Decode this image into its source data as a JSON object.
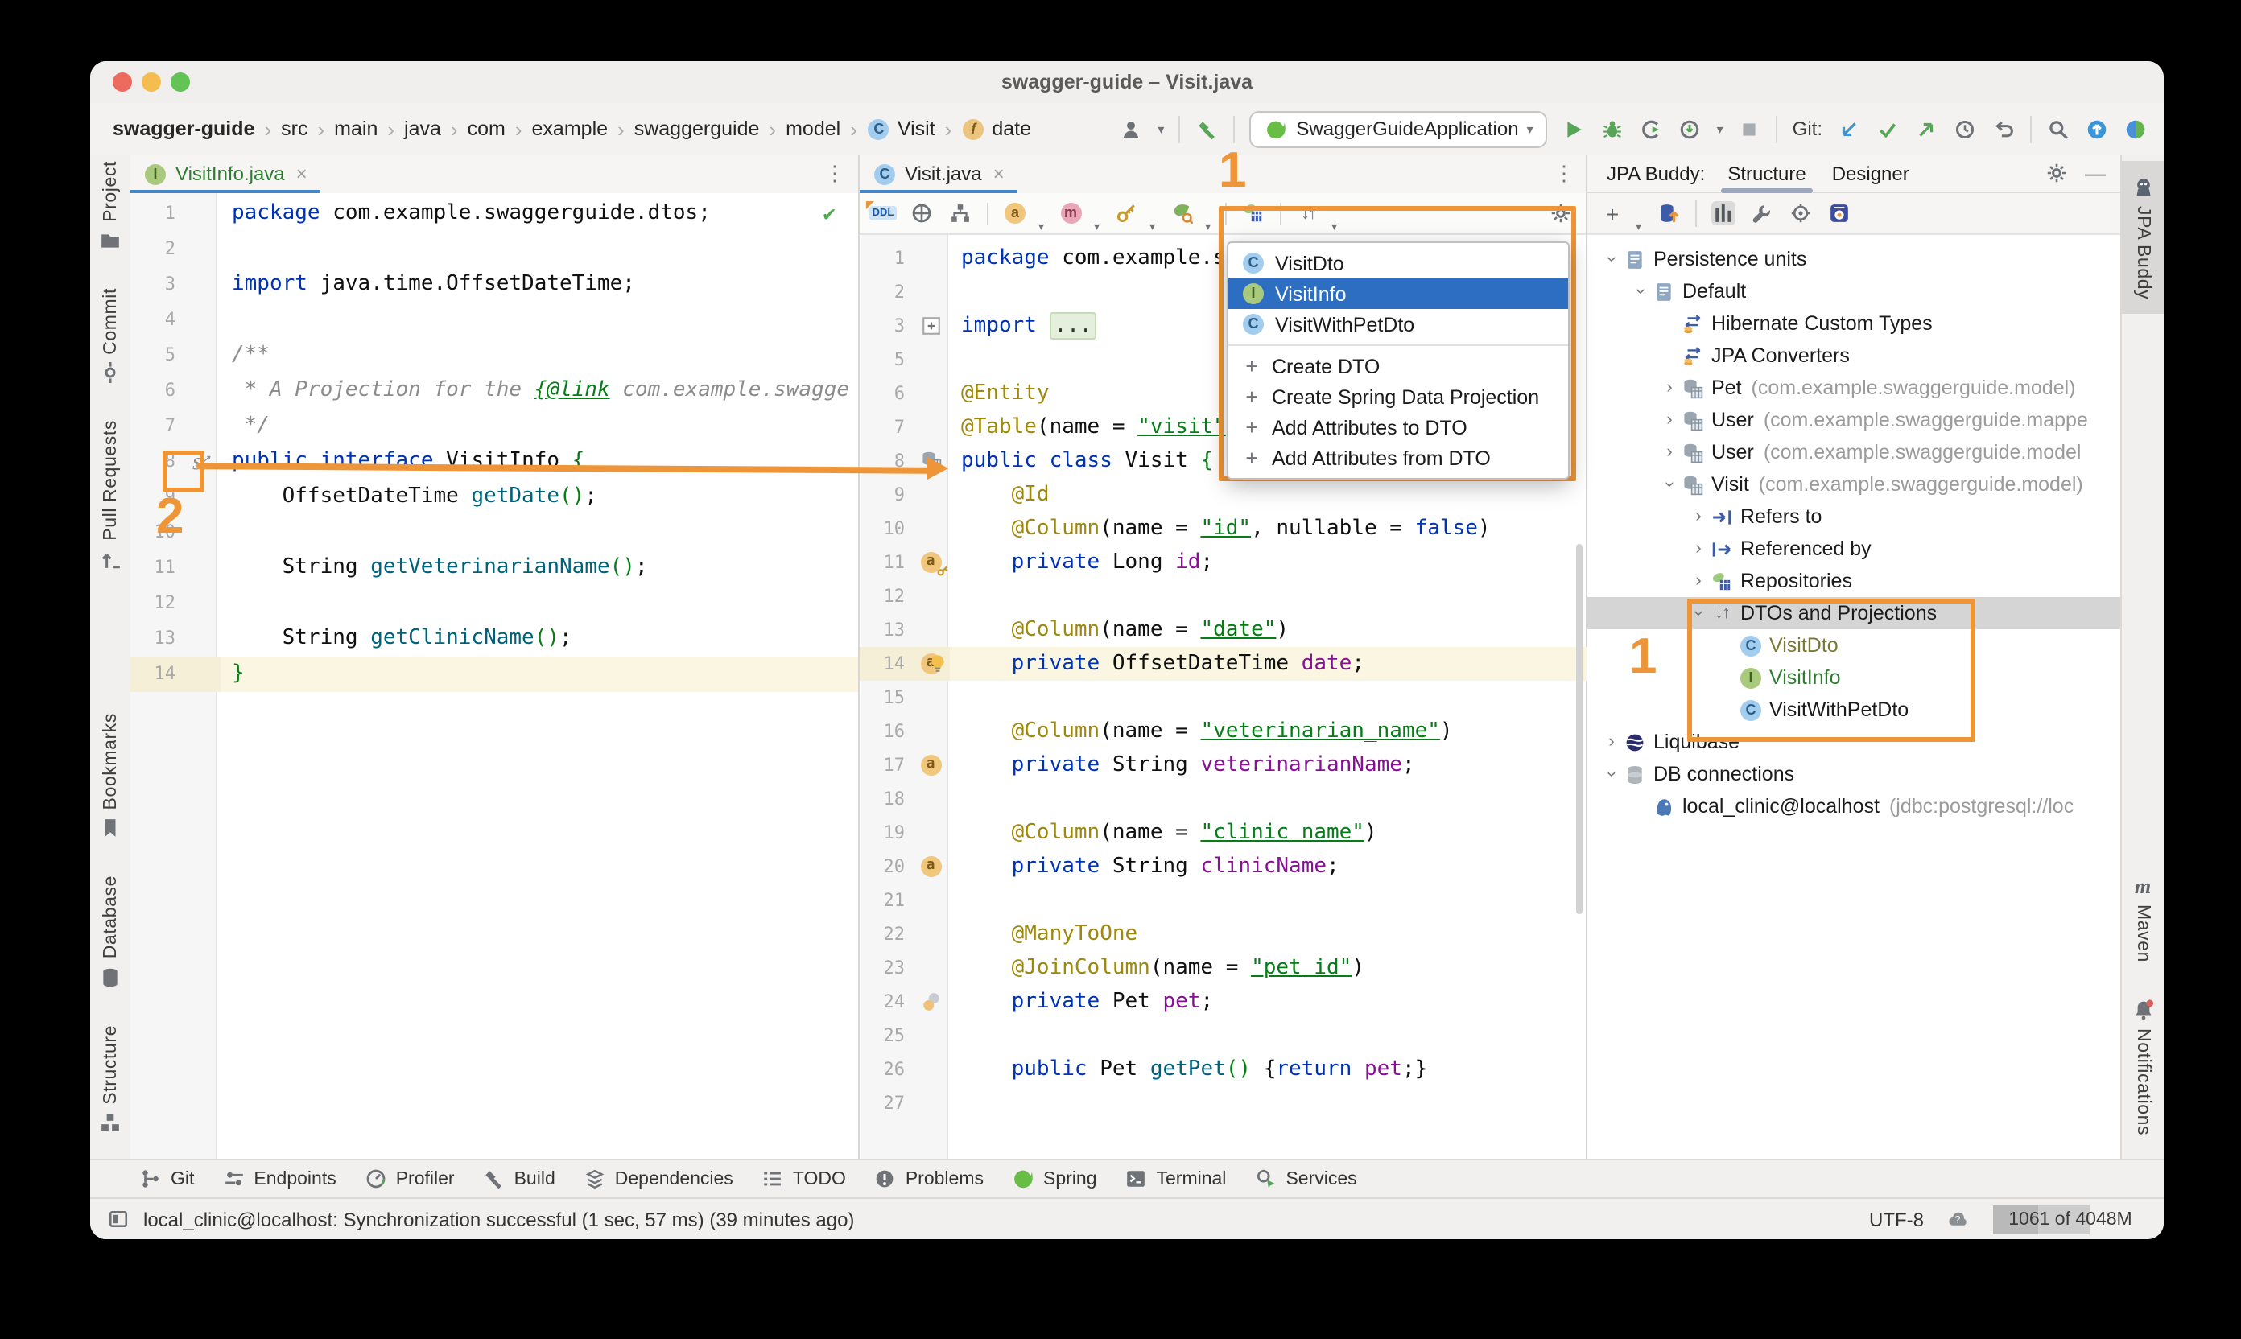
{
  "window": {
    "title": "swagger-guide – Visit.java"
  },
  "colors": {
    "annotation_orange": "#EE9637",
    "selection_blue": "#2D6EC3",
    "tab_underline": "#4285C9"
  },
  "breadcrumbs": {
    "items": [
      {
        "label": "swagger-guide",
        "bold": true
      },
      {
        "label": "src"
      },
      {
        "label": "main"
      },
      {
        "label": "java"
      },
      {
        "label": "com"
      },
      {
        "label": "example"
      },
      {
        "label": "swaggerguide"
      },
      {
        "label": "model"
      },
      {
        "label": "Visit",
        "icon": "class"
      },
      {
        "label": "date",
        "icon": "field"
      }
    ]
  },
  "toolbar": {
    "run_config": "SwaggerGuideApplication",
    "git_label": "Git:"
  },
  "left_stripe": {
    "top": [
      {
        "label": "Project",
        "icon": "folder"
      },
      {
        "label": "Commit",
        "icon": "commit"
      },
      {
        "label": "Pull Requests",
        "icon": "pr"
      }
    ],
    "bottom": [
      {
        "label": "Bookmarks",
        "icon": "bookmarks"
      },
      {
        "label": "Database",
        "icon": "database"
      },
      {
        "label": "Structure",
        "icon": "structure"
      }
    ]
  },
  "right_stripe": {
    "top": [
      {
        "label": "JPA Buddy",
        "icon": "jpabuddy",
        "selected": true
      }
    ],
    "bottom": [
      {
        "label": "Maven",
        "icon": "maven"
      },
      {
        "label": "Notifications",
        "icon": "bell"
      }
    ]
  },
  "editor_left": {
    "tab": "VisitInfo.java",
    "lines": [
      {
        "n": "1",
        "tk": [
          [
            "kw",
            "package"
          ],
          [
            "pl",
            " com.example.swaggerguide.dtos;"
          ]
        ]
      },
      {
        "n": "2"
      },
      {
        "n": "3",
        "tk": [
          [
            "kw",
            "import"
          ],
          [
            "pl",
            " java.time.OffsetDateTime;"
          ]
        ]
      },
      {
        "n": "4"
      },
      {
        "n": "5",
        "tk": [
          [
            "cm",
            "/**"
          ]
        ]
      },
      {
        "n": "6",
        "tk": [
          [
            "cm",
            " * A Projection for the "
          ],
          [
            "cml",
            "{@link"
          ],
          [
            "cm",
            " com.example.swagge"
          ]
        ]
      },
      {
        "n": "7",
        "tk": [
          [
            "cm",
            " */"
          ]
        ]
      },
      {
        "n": "8",
        "g": "proj",
        "tk": [
          [
            "kw",
            "public"
          ],
          [
            "pl",
            " "
          ],
          [
            "kw",
            "interface"
          ],
          [
            "pl",
            " VisitInfo "
          ],
          [
            "gr",
            "{"
          ]
        ]
      },
      {
        "n": "9",
        "tk": [
          [
            "pl",
            "    OffsetDateTime "
          ],
          [
            "mt",
            "getDate"
          ],
          [
            "gr",
            "()"
          ],
          [
            "pl",
            ";"
          ]
        ]
      },
      {
        "n": "10"
      },
      {
        "n": "11",
        "tk": [
          [
            "pl",
            "    String "
          ],
          [
            "mt",
            "getVeterinarianName"
          ],
          [
            "gr",
            "()"
          ],
          [
            "pl",
            ";"
          ]
        ]
      },
      {
        "n": "12"
      },
      {
        "n": "13",
        "tk": [
          [
            "pl",
            "    String "
          ],
          [
            "mt",
            "getClinicName"
          ],
          [
            "gr",
            "()"
          ],
          [
            "pl",
            ";"
          ]
        ]
      },
      {
        "n": "14",
        "hl": true,
        "tk": [
          [
            "gr",
            "}"
          ]
        ]
      }
    ]
  },
  "editor_right": {
    "tab": "Visit.java",
    "lines": [
      {
        "n": "1",
        "tk": [
          [
            "kw",
            "package"
          ],
          [
            "pl",
            " com.example.s"
          ]
        ]
      },
      {
        "n": "2"
      },
      {
        "n": "3",
        "g": "fold",
        "tk": [
          [
            "kw",
            "import"
          ],
          [
            "pl",
            " "
          ],
          [
            "fold",
            "..."
          ]
        ]
      },
      {
        "n": "5"
      },
      {
        "n": "6",
        "tk": [
          [
            "an",
            "@Entity"
          ]
        ]
      },
      {
        "n": "7",
        "tk": [
          [
            "an",
            "@Table"
          ],
          [
            "pl",
            "(name = "
          ],
          [
            "st",
            "\"visit\""
          ],
          [
            "pl",
            ")"
          ]
        ]
      },
      {
        "n": "8",
        "g": "entity",
        "tk": [
          [
            "kw",
            "public"
          ],
          [
            "pl",
            " "
          ],
          [
            "kw",
            "class"
          ],
          [
            "pl",
            " Visit "
          ],
          [
            "gr",
            "{"
          ]
        ]
      },
      {
        "n": "9",
        "tk": [
          [
            "pl",
            "    "
          ],
          [
            "an",
            "@Id"
          ]
        ]
      },
      {
        "n": "10",
        "tk": [
          [
            "pl",
            "    "
          ],
          [
            "an",
            "@Column"
          ],
          [
            "pl",
            "(name = "
          ],
          [
            "st",
            "\"id\""
          ],
          [
            "pl",
            ", nullable = "
          ],
          [
            "kw",
            "false"
          ],
          [
            "pl",
            ")"
          ]
        ]
      },
      {
        "n": "11",
        "g": "attrkey",
        "tk": [
          [
            "pl",
            "    "
          ],
          [
            "kw",
            "private"
          ],
          [
            "pl",
            " Long "
          ],
          [
            "fd",
            "id"
          ],
          [
            "pl",
            ";"
          ]
        ]
      },
      {
        "n": "12"
      },
      {
        "n": "13",
        "tk": [
          [
            "pl",
            "    "
          ],
          [
            "an",
            "@Column"
          ],
          [
            "pl",
            "(name = "
          ],
          [
            "st",
            "\"date\""
          ],
          [
            "pl",
            ")"
          ]
        ]
      },
      {
        "n": "14",
        "hl": true,
        "g": "attr",
        "bulb": true,
        "tk": [
          [
            "pl",
            "    "
          ],
          [
            "kw",
            "private"
          ],
          [
            "pl",
            " OffsetDateTime "
          ],
          [
            "fd",
            "date"
          ],
          [
            "pl",
            ";"
          ]
        ]
      },
      {
        "n": "15"
      },
      {
        "n": "16",
        "tk": [
          [
            "pl",
            "    "
          ],
          [
            "an",
            "@Column"
          ],
          [
            "pl",
            "(name = "
          ],
          [
            "st",
            "\"veterinarian_name\""
          ],
          [
            "pl",
            ")"
          ]
        ]
      },
      {
        "n": "17",
        "g": "attr",
        "tk": [
          [
            "pl",
            "    "
          ],
          [
            "kw",
            "private"
          ],
          [
            "pl",
            " String "
          ],
          [
            "fd",
            "veterinarianName"
          ],
          [
            "pl",
            ";"
          ]
        ]
      },
      {
        "n": "18"
      },
      {
        "n": "19",
        "tk": [
          [
            "pl",
            "    "
          ],
          [
            "an",
            "@Column"
          ],
          [
            "pl",
            "(name = "
          ],
          [
            "st",
            "\"clinic_name\""
          ],
          [
            "pl",
            ")"
          ]
        ]
      },
      {
        "n": "20",
        "g": "attr",
        "tk": [
          [
            "pl",
            "    "
          ],
          [
            "kw",
            "private"
          ],
          [
            "pl",
            " String "
          ],
          [
            "fd",
            "clinicName"
          ],
          [
            "pl",
            ";"
          ]
        ]
      },
      {
        "n": "21"
      },
      {
        "n": "22",
        "tk": [
          [
            "pl",
            "    "
          ],
          [
            "an",
            "@ManyToOne"
          ]
        ]
      },
      {
        "n": "23",
        "tk": [
          [
            "pl",
            "    "
          ],
          [
            "an",
            "@JoinColumn"
          ],
          [
            "pl",
            "(name = "
          ],
          [
            "st",
            "\"pet_id\""
          ],
          [
            "pl",
            ")"
          ]
        ]
      },
      {
        "n": "24",
        "g": "assoc",
        "tk": [
          [
            "pl",
            "    "
          ],
          [
            "kw",
            "private"
          ],
          [
            "pl",
            " Pet "
          ],
          [
            "fd",
            "pet"
          ],
          [
            "pl",
            ";"
          ]
        ]
      },
      {
        "n": "25"
      },
      {
        "n": "26",
        "tk": [
          [
            "pl",
            "    "
          ],
          [
            "kw",
            "public"
          ],
          [
            "pl",
            " Pet "
          ],
          [
            "mt",
            "getPet"
          ],
          [
            "gr",
            "()"
          ],
          [
            "pl",
            " {"
          ],
          [
            "kw",
            "return"
          ],
          [
            "pl",
            " "
          ],
          [
            "fd",
            "pet"
          ],
          [
            "pl",
            ";}"
          ]
        ]
      },
      {
        "n": "27"
      }
    ]
  },
  "popup": {
    "entries": [
      {
        "icon": "class",
        "label": "VisitDto"
      },
      {
        "icon": "iface",
        "label": "VisitInfo",
        "selected": true
      },
      {
        "icon": "class",
        "label": "VisitWithPetDto"
      }
    ],
    "actions": [
      {
        "label": "Create DTO"
      },
      {
        "label": "Create Spring Data Projection"
      },
      {
        "label": "Add Attributes to DTO"
      },
      {
        "label": "Add Attributes from DTO"
      }
    ]
  },
  "jpa_panel": {
    "title": "JPA Buddy:",
    "tabs": [
      {
        "label": "Structure",
        "selected": true
      },
      {
        "label": "Designer"
      }
    ],
    "tree": [
      {
        "d": 0,
        "ch": "exp",
        "icon": "punit",
        "label": "Persistence units"
      },
      {
        "d": 1,
        "ch": "exp",
        "icon": "punit",
        "label": "Default"
      },
      {
        "d": 2,
        "ch": null,
        "icon": "conv",
        "label": "Hibernate Custom Types"
      },
      {
        "d": 2,
        "ch": null,
        "icon": "conv",
        "label": "JPA Converters"
      },
      {
        "d": 2,
        "ch": "col",
        "icon": "entity",
        "label": "Pet",
        "sub": "(com.example.swaggerguide.model)"
      },
      {
        "d": 2,
        "ch": "col",
        "icon": "entity",
        "label": "User",
        "sub": "(com.example.swaggerguide.mappe"
      },
      {
        "d": 2,
        "ch": "col",
        "icon": "entity",
        "label": "User",
        "sub": "(com.example.swaggerguide.model"
      },
      {
        "d": 2,
        "ch": "exp",
        "icon": "entity",
        "label": "Visit",
        "sub": "(com.example.swaggerguide.model)"
      },
      {
        "d": 3,
        "ch": "col",
        "icon": "refto",
        "label": "Refers to"
      },
      {
        "d": 3,
        "ch": "col",
        "icon": "refby",
        "label": "Referenced by"
      },
      {
        "d": 3,
        "ch": "col",
        "icon": "repo",
        "label": "Repositories"
      },
      {
        "d": 3,
        "ch": "exp",
        "icon": "sortt",
        "label": "DTOs and Projections",
        "selected": true
      },
      {
        "d": 4,
        "ch": null,
        "icon": "class",
        "label": "VisitDto",
        "color": "olive"
      },
      {
        "d": 4,
        "ch": null,
        "icon": "iface",
        "label": "VisitInfo",
        "color": "green"
      },
      {
        "d": 4,
        "ch": null,
        "icon": "class",
        "label": "VisitWithPetDto"
      },
      {
        "d": 0,
        "ch": "col",
        "icon": "liqui",
        "label": "Liquibase"
      },
      {
        "d": 0,
        "ch": "exp",
        "icon": "dbgray",
        "label": "DB connections"
      },
      {
        "d": 1,
        "ch": null,
        "icon": "pg",
        "label": "local_clinic@localhost",
        "sub": "(jdbc:postgresql://loc"
      }
    ]
  },
  "tool_buttons": [
    {
      "label": "Git",
      "icon": "git"
    },
    {
      "label": "Endpoints",
      "icon": "endpoints"
    },
    {
      "label": "Profiler",
      "icon": "profiler"
    },
    {
      "label": "Build",
      "icon": "build"
    },
    {
      "label": "Dependencies",
      "icon": "deps"
    },
    {
      "label": "TODO",
      "icon": "todo"
    },
    {
      "label": "Problems",
      "icon": "problems"
    },
    {
      "label": "Spring",
      "icon": "spring"
    },
    {
      "label": "Terminal",
      "icon": "terminal"
    },
    {
      "label": "Services",
      "icon": "services"
    }
  ],
  "status_bar": {
    "message": "local_clinic@localhost: Synchronization successful (1 sec, 57 ms) (39 minutes ago)",
    "encoding": "UTF-8",
    "memory": "1061 of 4048M"
  },
  "annotations": {
    "popup_step": "1",
    "panel_step": "1",
    "gutter_step": "2"
  }
}
